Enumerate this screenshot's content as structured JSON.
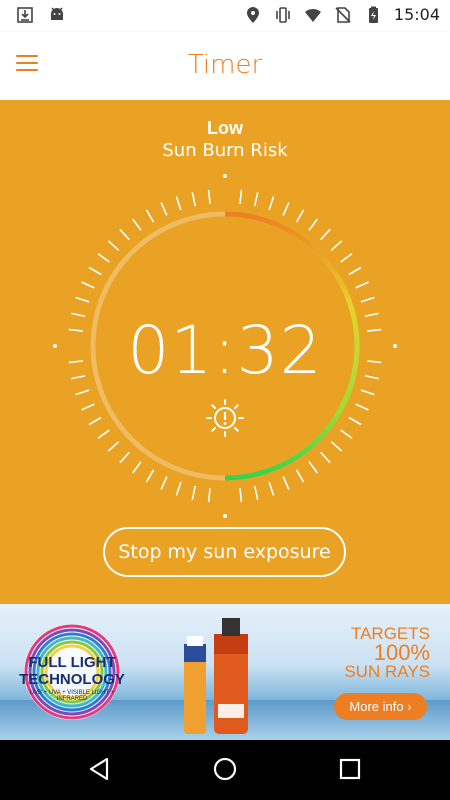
{
  "status_bar": {
    "time": "15:04",
    "icons": [
      "download-icon",
      "android-icon",
      "location-icon",
      "vibrate-icon",
      "wifi-icon",
      "no-sim-icon",
      "battery-charging-icon"
    ]
  },
  "app_bar": {
    "title": "Timer",
    "menu_icon": "hamburger-menu-icon"
  },
  "risk": {
    "level": "Low",
    "label": "Sun Burn Risk"
  },
  "timer": {
    "value": "01:32",
    "progress_fraction": 0.5,
    "icon": "sun-warning-icon",
    "colors": {
      "start": "#EE7E22",
      "mid": "#E9D22A",
      "end": "#3BD04B"
    }
  },
  "actions": {
    "stop_label": "Stop my sun exposure"
  },
  "banner": {
    "logo_line1": "FULL LIGHT",
    "logo_line2": "TECHNOLOGY",
    "logo_sub": "UVB + UVA + VISIBLE LIGHT + INFRARED",
    "headline_line1": "TARGETS",
    "headline_line2": "100%",
    "headline_line3": "SUN RAYS",
    "more_label": "More info"
  },
  "nav": {
    "icons": [
      "back-icon",
      "home-icon",
      "recents-icon"
    ]
  },
  "colors": {
    "accent": "#EE7E22",
    "background": "#E9A224",
    "white": "#FFFFFF"
  }
}
